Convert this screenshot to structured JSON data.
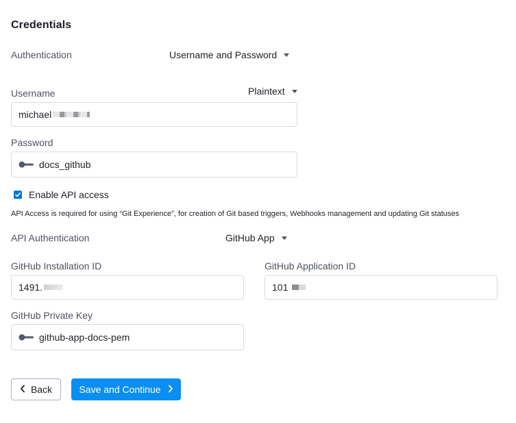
{
  "section": {
    "title": "Credentials"
  },
  "authentication": {
    "label": "Authentication",
    "selected": "Username and Password"
  },
  "username": {
    "label": "Username",
    "mode": "Plaintext",
    "value": "michael"
  },
  "password": {
    "label": "Password",
    "value": "docs_github"
  },
  "api_access": {
    "checkbox_label": "Enable API access",
    "checked": true,
    "hint": "API Access is required for using “Git Experience”, for creation of Git based triggers, Webhooks management and updating Git statuses"
  },
  "api_auth": {
    "label": "API Authentication",
    "selected": "GitHub App"
  },
  "installation_id": {
    "label": "GitHub Installation ID",
    "value": "1491."
  },
  "application_id": {
    "label": "GitHub Application ID",
    "value": "101"
  },
  "private_key": {
    "label": "GitHub Private Key",
    "value": "github-app-docs-pem"
  },
  "buttons": {
    "back": "Back",
    "save": "Save and Continue"
  },
  "icons": {
    "secret": "key-icon",
    "dropdown": "caret-down-icon",
    "back": "chevron-left-icon",
    "next": "chevron-right-icon",
    "checkbox": "check-icon"
  },
  "colors": {
    "primary": "#0a8ef0",
    "checkbox": "#0278d5",
    "border": "#d9dae5",
    "label": "#4f5162"
  }
}
